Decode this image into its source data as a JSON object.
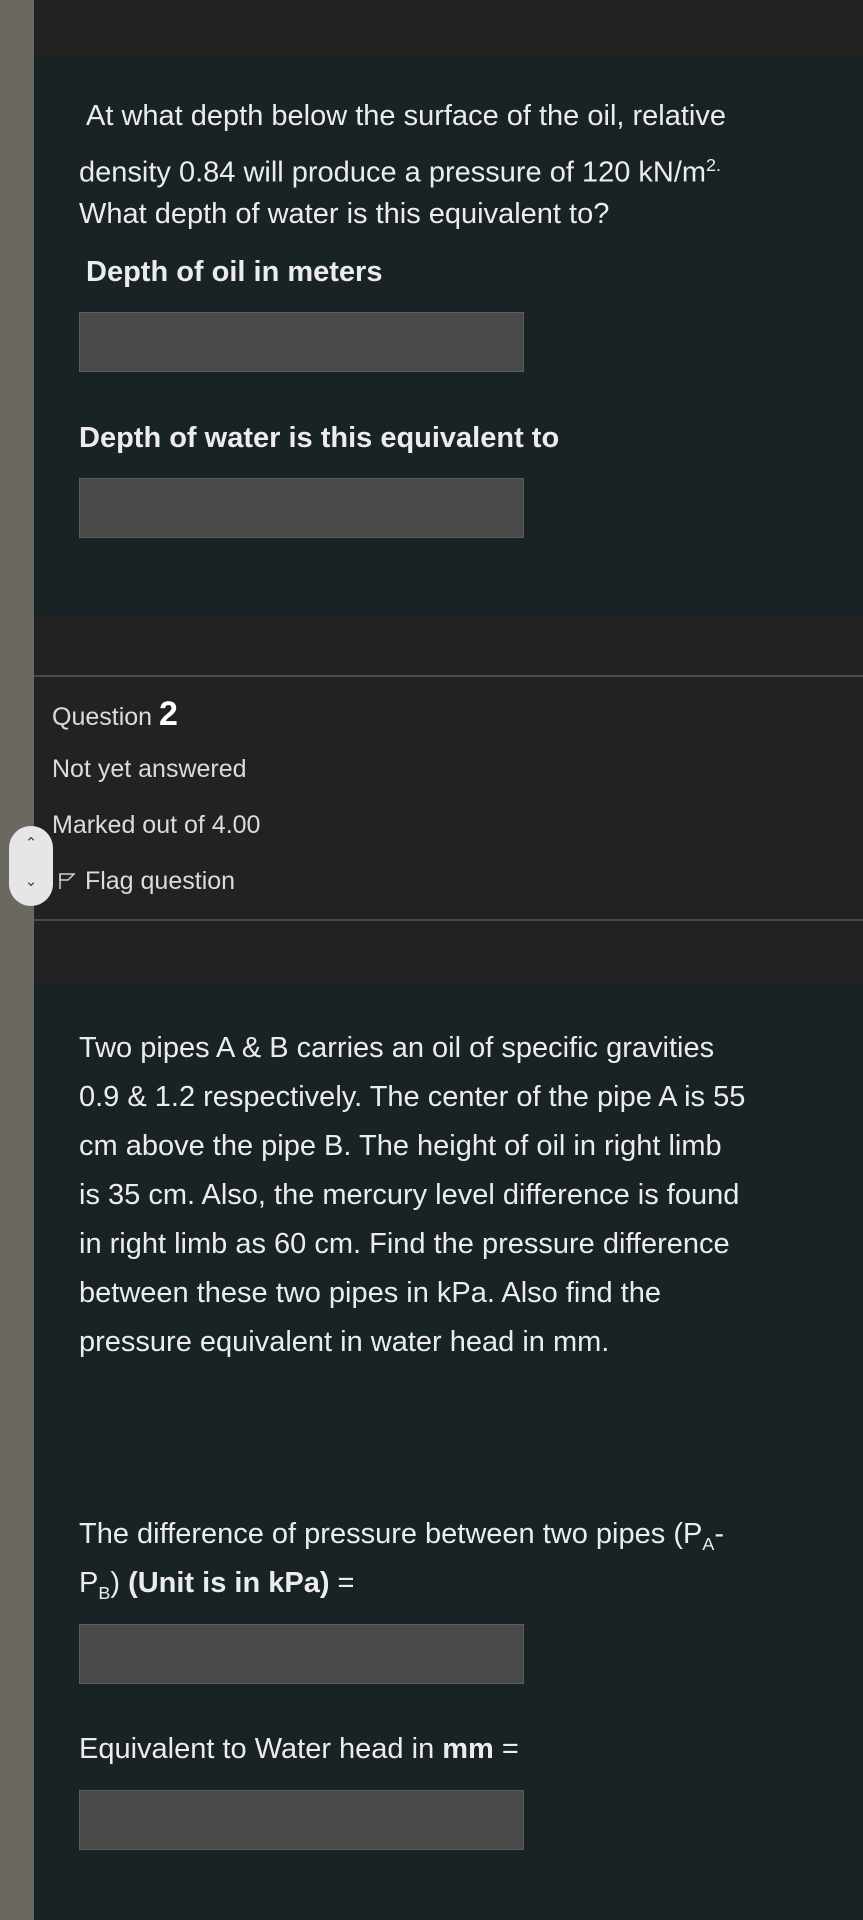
{
  "q1": {
    "text_line1": "At what depth below the surface of the oil, relative",
    "text_line2a": "density 0.84 will produce a pressure of 120 kN/m",
    "text_line2_sup": "2.",
    "text_line3": "What depth of water is this equivalent to?",
    "label_oil": "Depth of oil in meters",
    "label_water": "Depth of water is this equivalent to"
  },
  "q2_info": {
    "question_word": "Question",
    "question_number": "2",
    "status": "Not yet answered",
    "marks": "Marked out of 4.00",
    "flag_label": "Flag question"
  },
  "q2": {
    "text_lines": [
      "Two pipes A & B carries an oil of specific gravities",
      "0.9 & 1.2 respectively.  The center of the pipe A is 55",
      "cm above the pipe B.  The height of oil in right limb",
      "is 35 cm.  Also, the mercury level difference is found",
      "in right limb as 60 cm.  Find the pressure difference",
      "between these two pipes in kPa. Also find the",
      "pressure  equivalent in water head in mm."
    ],
    "diff_label_a": "The difference of pressure between two pipes (P",
    "diff_sub_a": "A",
    "diff_label_b": "-",
    "diff_label_c": "P",
    "diff_sub_b": "B",
    "diff_label_d": ")  ",
    "diff_unit": "(Unit is in kPa)",
    "diff_eq": " =",
    "water_label_a": "Equivalent to Water head in ",
    "water_label_unit": "mm",
    "water_label_eq": " ="
  },
  "icons": {
    "flag": "flag-icon",
    "scroll_up": "chevron-up-icon",
    "scroll_down": "chevron-down-icon"
  }
}
